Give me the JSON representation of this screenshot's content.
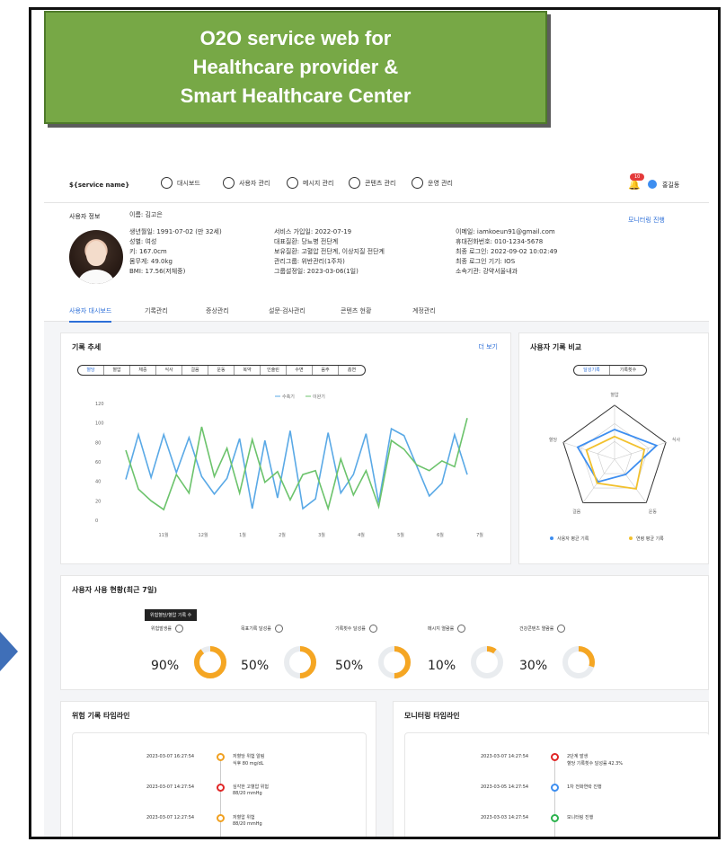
{
  "banner": {
    "line1": "O2O service web for",
    "line2": "Healthcare provider &",
    "line3": "Smart Healthcare Center"
  },
  "topbar": {
    "service_name": "${service name}",
    "nav": [
      "대시보드",
      "사용자 관리",
      "메시지 관리",
      "콘텐츠 관리",
      "운영 관리"
    ],
    "notification_count": "10",
    "user_name": "홍길동"
  },
  "user_info": {
    "section_label": "사용자 정보",
    "name": "이름: 김고은",
    "col1": [
      "생년월일: 1991-07-02 (만 32세)",
      "성별: 여성",
      "키: 167.0cm",
      "몸무게: 49.0kg",
      "BMI: 17.56(저체중)"
    ],
    "col2": [
      "서비스 가입일: 2022-07-19",
      "대표질환: 당뇨병 전단계",
      "보유질환: 고혈압 전단계, 이상지질 전단계",
      "관리그룹: 위반관리(1주차)",
      "그룹설정일: 2023-03-06(1일)"
    ],
    "col3": [
      "이메일: iamkoeun91@gmail.com",
      "휴대전화번호: 010-1234-5678",
      "최종 로그인: 2022-09-02 10:02:49",
      "최종 로그인 기기: IOS",
      "소속기관: 강약서울내과"
    ],
    "monitoring_button": "모니터링 진행"
  },
  "tabs": [
    "사용자 대시보드",
    "기록관리",
    "증상관리",
    "설문·검사관리",
    "콘텐츠 현황",
    "계정관리"
  ],
  "record_trend": {
    "title": "기록 추세",
    "more": "더 보기",
    "segments": [
      "혈당",
      "혈압",
      "체중",
      "식사",
      "걸음",
      "운동",
      "복약",
      "인슐린",
      "수면",
      "음주",
      "흡연"
    ],
    "legend": [
      "수축기",
      "이완기"
    ]
  },
  "compare": {
    "title": "사용자 기록 비교",
    "toggle": [
      "달성기록",
      "기록횟수"
    ],
    "axes": [
      "혈압",
      "식사",
      "운동",
      "걸음",
      "혈당"
    ],
    "legend": [
      "사용자 평균 기록",
      "연령 평균 기록"
    ],
    "user_color": "#3d8ef0",
    "age_color": "#f2c12e"
  },
  "usage": {
    "title": "사용자 사용 현황(최근 7일)",
    "tooltip": "위험혈당/혈압 기록 수",
    "items": [
      {
        "label": "위험발생률",
        "value": "90%",
        "pct": 0.9
      },
      {
        "label": "목표기록 달성률",
        "value": "50%",
        "pct": 0.5
      },
      {
        "label": "기록횟수 달성률",
        "value": "50%",
        "pct": 0.5
      },
      {
        "label": "메시지 열람률",
        "value": "10%",
        "pct": 0.1
      },
      {
        "label": "건강콘텐츠 열람률",
        "value": "30%",
        "pct": 0.3
      }
    ],
    "ring_color": "#f5a623",
    "track_color": "#e9ecef"
  },
  "risk_timeline": {
    "title": "위험 기록 타임라인",
    "rows": [
      {
        "time": "2023-03-07 16:27:54",
        "text1": "저혈당 위험 알림",
        "text2": "식후 80 mg/dL",
        "color": "#f0a020"
      },
      {
        "time": "2023-03-07 14:27:54",
        "text1": "심각한 고혈압 위험",
        "text2": "88/20 mmHg",
        "color": "#e02626"
      },
      {
        "time": "2023-03-07 12:27:54",
        "text1": "저혈압 위험",
        "text2": "88/20 mmHg",
        "color": "#f0a020"
      }
    ]
  },
  "monitor_timeline": {
    "title": "모니터링 타임라인",
    "rows": [
      {
        "time": "2023-03-07 14:27:54",
        "text1": "2단계 발생",
        "text2": "혈당 기록횟수 달성률 42.3%",
        "color": "#e02626"
      },
      {
        "time": "2023-03-05 14:27:54",
        "text1": "1차 전화연락 진행",
        "text2": "",
        "color": "#3d8ef0"
      },
      {
        "time": "2023-03-03 14:27:54",
        "text1": "모니터링 진행",
        "text2": "",
        "color": "#2bb24c"
      }
    ]
  },
  "chart_data": [
    {
      "type": "line",
      "title": "",
      "categories": [
        "11월",
        "12월",
        "1월",
        "2월",
        "3월",
        "4월",
        "5월",
        "6월",
        "7월"
      ],
      "yticks": [
        0,
        20,
        40,
        60,
        80,
        100,
        120
      ],
      "ylim": [
        0,
        120
      ],
      "series": [
        {
          "name": "수축기",
          "color": "#5aa9e6",
          "values": [
            42,
            88,
            44,
            88,
            49,
            85,
            45,
            27,
            43,
            84,
            12,
            82,
            23,
            92,
            12,
            22,
            90,
            28,
            47,
            89,
            18,
            94,
            87,
            56,
            25,
            38,
            88,
            47
          ]
        },
        {
          "name": "이완기",
          "color": "#6cc36c",
          "values": [
            72,
            32,
            20,
            11,
            47,
            28,
            96,
            45,
            74,
            28,
            83,
            39,
            50,
            21,
            47,
            51,
            12,
            63,
            26,
            51,
            14,
            82,
            73,
            57,
            51,
            61,
            55,
            105
          ]
        }
      ]
    },
    {
      "type": "radar",
      "axes": [
        "혈압",
        "식사",
        "운동",
        "걸음",
        "혈당"
      ],
      "series": [
        {
          "name": "사용자 평균 기록",
          "color": "#3d8ef0",
          "values": [
            0.55,
            0.82,
            0.35,
            0.52,
            0.72
          ]
        },
        {
          "name": "연령 평균 기록",
          "color": "#f2c12e",
          "values": [
            0.42,
            0.58,
            0.68,
            0.55,
            0.55
          ]
        }
      ]
    }
  ]
}
